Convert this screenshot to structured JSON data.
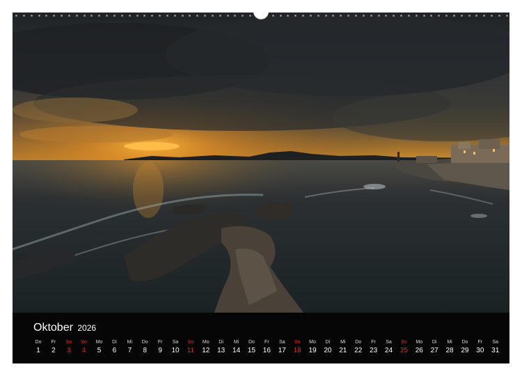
{
  "calendar": {
    "month": "Oktober",
    "year": "2026",
    "days": [
      {
        "wd": "Do",
        "num": "1",
        "red": false
      },
      {
        "wd": "Fr",
        "num": "2",
        "red": false
      },
      {
        "wd": "Sa",
        "num": "3",
        "red": true
      },
      {
        "wd": "So",
        "num": "4",
        "red": true
      },
      {
        "wd": "Mo",
        "num": "5",
        "red": false
      },
      {
        "wd": "Di",
        "num": "6",
        "red": false
      },
      {
        "wd": "Mi",
        "num": "7",
        "red": false
      },
      {
        "wd": "Do",
        "num": "8",
        "red": false
      },
      {
        "wd": "Fr",
        "num": "9",
        "red": false
      },
      {
        "wd": "Sa",
        "num": "10",
        "red": false
      },
      {
        "wd": "So",
        "num": "11",
        "red": true
      },
      {
        "wd": "Mo",
        "num": "12",
        "red": false
      },
      {
        "wd": "Di",
        "num": "13",
        "red": false
      },
      {
        "wd": "Mi",
        "num": "14",
        "red": false
      },
      {
        "wd": "Do",
        "num": "15",
        "red": false
      },
      {
        "wd": "Fr",
        "num": "16",
        "red": false
      },
      {
        "wd": "Sa",
        "num": "17",
        "red": false
      },
      {
        "wd": "So",
        "num": "18",
        "red": true
      },
      {
        "wd": "Mo",
        "num": "19",
        "red": false
      },
      {
        "wd": "Di",
        "num": "20",
        "red": false
      },
      {
        "wd": "Mi",
        "num": "21",
        "red": false
      },
      {
        "wd": "Do",
        "num": "22",
        "red": false
      },
      {
        "wd": "Fr",
        "num": "23",
        "red": false
      },
      {
        "wd": "Sa",
        "num": "24",
        "red": false
      },
      {
        "wd": "So",
        "num": "25",
        "red": true
      },
      {
        "wd": "Mo",
        "num": "26",
        "red": false
      },
      {
        "wd": "Di",
        "num": "27",
        "red": false
      },
      {
        "wd": "Mi",
        "num": "28",
        "red": false
      },
      {
        "wd": "Do",
        "num": "29",
        "red": false
      },
      {
        "wd": "Fr",
        "num": "30",
        "red": false
      },
      {
        "wd": "Sa",
        "num": "31",
        "red": false
      }
    ]
  },
  "colors": {
    "weekend_red": "#e0222a",
    "calendar_bar": "#060606"
  }
}
